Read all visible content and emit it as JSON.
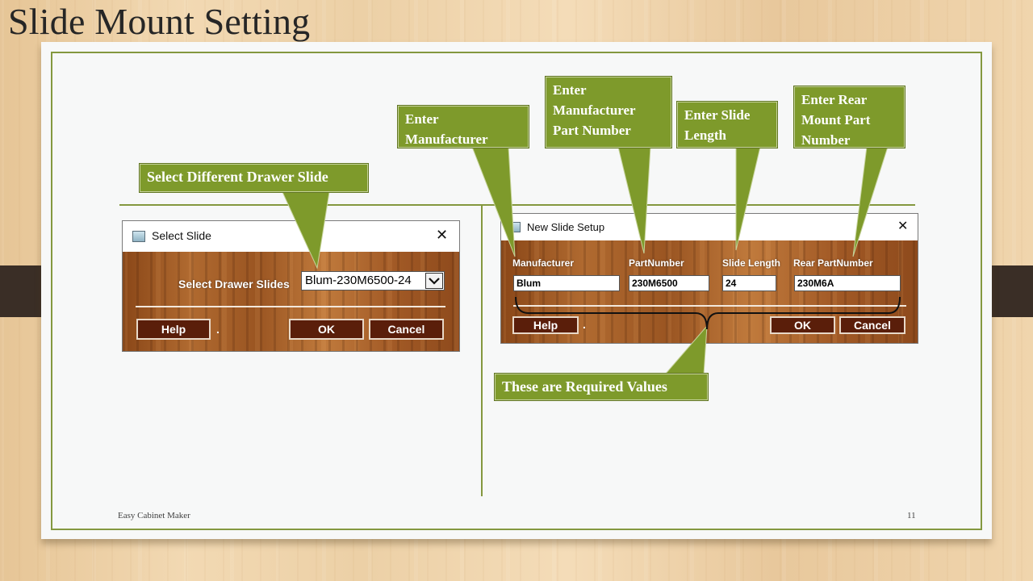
{
  "slide": {
    "title": "Slide Mount Setting",
    "footer_left": "Easy Cabinet Maker",
    "page_number": "11"
  },
  "select_slide_dialog": {
    "title": "Select Slide",
    "close_glyph": "✕",
    "field_label": "Select Drawer Slides",
    "selected_value": "Blum-230M6500-24",
    "dropdown_glyph": "⌄",
    "help_label": "Help",
    "dot": ".",
    "ok_label": "OK",
    "cancel_label": "Cancel"
  },
  "new_slide_dialog": {
    "title": "New Slide Setup",
    "close_glyph": "✕",
    "fields": [
      {
        "label": "Manufacturer",
        "value": "Blum"
      },
      {
        "label": "PartNumber",
        "value": "230M6500"
      },
      {
        "label": "Slide Length",
        "value": "24"
      },
      {
        "label": "Rear PartNumber",
        "value": "230M6A"
      }
    ],
    "help_label": "Help",
    "dot": ".",
    "ok_label": "OK",
    "cancel_label": "Cancel"
  },
  "callouts": {
    "select_different": "Select Different Drawer Slide",
    "enter_manufacturer": "Enter Manufacturer",
    "enter_part_number": "Enter Manufacturer Part Number",
    "enter_slide_length": "Enter Slide Length",
    "enter_rear_mount": "Enter Rear Mount Part Number",
    "required_values": "These are Required Values"
  },
  "colors": {
    "callout_green": "#7e9a2b",
    "border_green": "#84983f",
    "button_brown": "#5a1e0a"
  }
}
